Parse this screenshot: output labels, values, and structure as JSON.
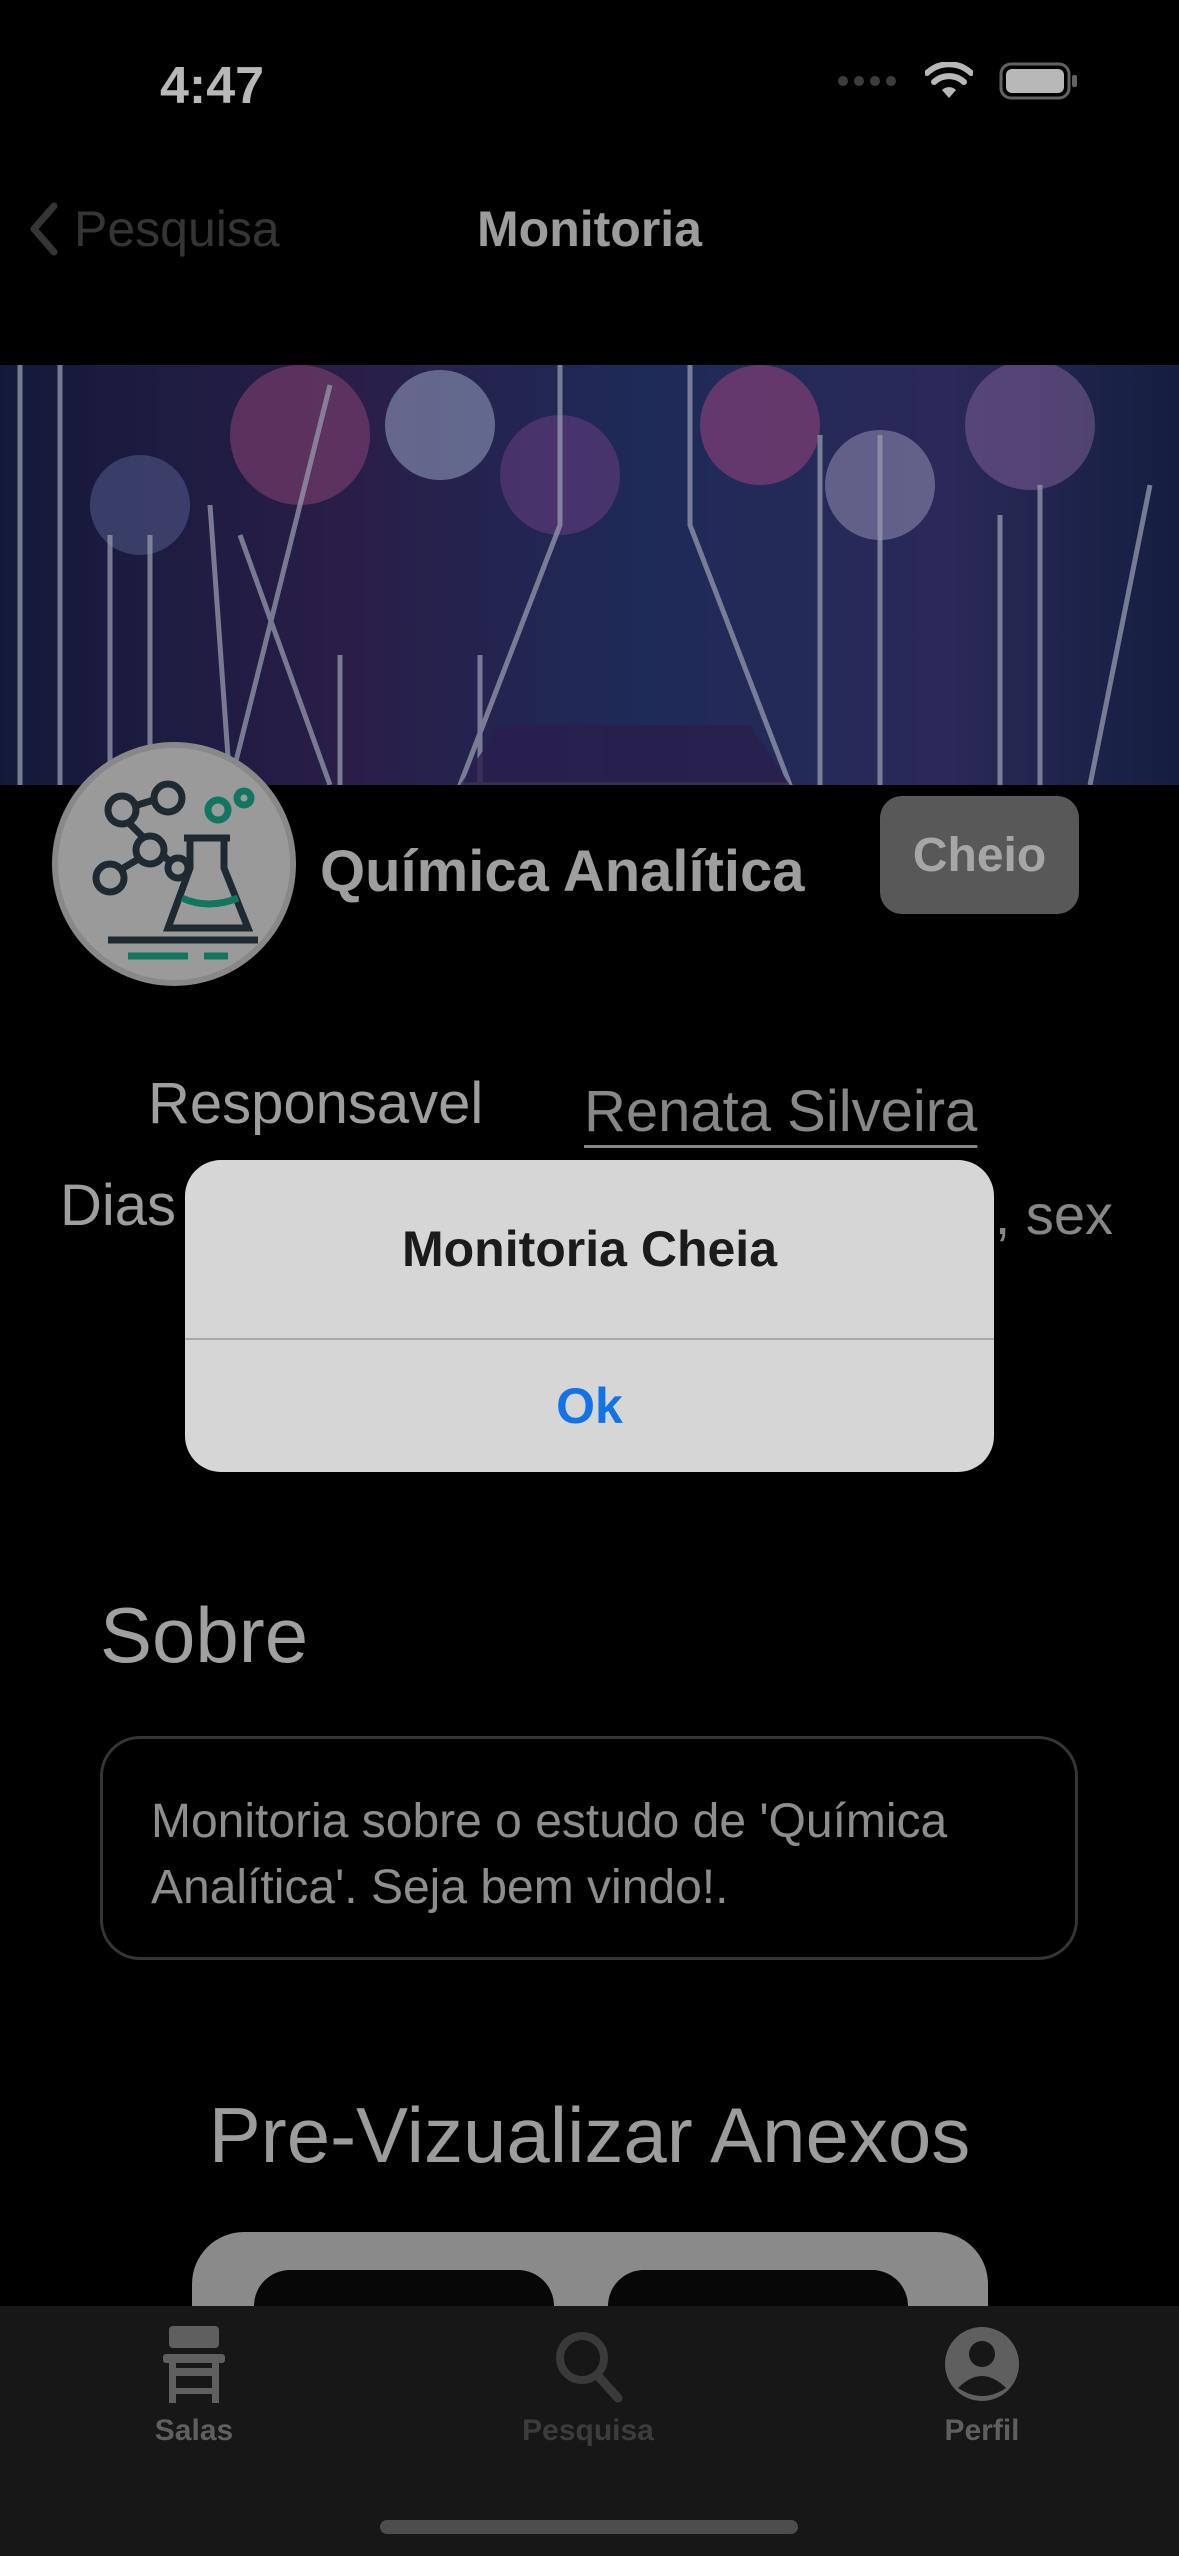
{
  "status_bar": {
    "time": "4:47"
  },
  "nav": {
    "back_label": "Pesquisa",
    "title": "Monitoria"
  },
  "subject": {
    "name": "Química Analítica",
    "status_badge": "Cheio"
  },
  "details": {
    "responsible_label": "Responsavel",
    "responsible_name": "Renata Silveira",
    "days_label": "Dias",
    "days_value_visible": ", sex"
  },
  "about": {
    "title": "Sobre",
    "text": "Monitoria sobre o estudo de 'Química Analítica'. Seja bem vindo!."
  },
  "attachments": {
    "title": "Pre-Vizualizar Anexos"
  },
  "alert": {
    "title": "Monitoria Cheia",
    "ok_label": "Ok"
  },
  "tab_bar": {
    "items": [
      {
        "label": "Salas",
        "icon": "desk-icon"
      },
      {
        "label": "Pesquisa",
        "icon": "search-icon"
      },
      {
        "label": "Perfil",
        "icon": "person-icon"
      }
    ]
  }
}
